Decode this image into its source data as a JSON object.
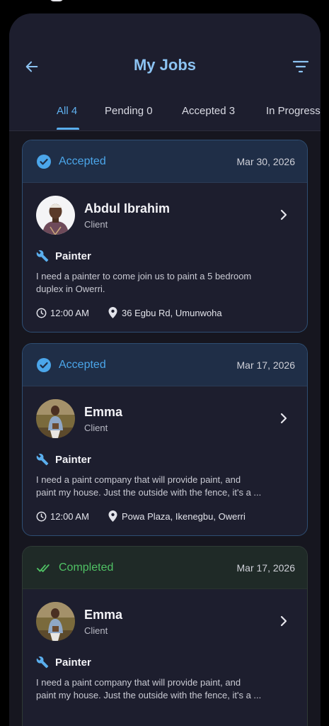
{
  "header": {
    "title": "My Jobs",
    "back_icon": "arrow-left-icon",
    "filter_icon": "filter-icon"
  },
  "tabs": [
    {
      "label": "All 4",
      "active": true
    },
    {
      "label": "Pending 0",
      "active": false
    },
    {
      "label": "Accepted 3",
      "active": false
    },
    {
      "label": "In Progress",
      "active": false
    }
  ],
  "colors": {
    "accent_blue": "#5fb0ef",
    "accepted": "#4ba6ea",
    "completed": "#4fc164",
    "background": "#16161f",
    "card": "#1d1e2e"
  },
  "jobs": [
    {
      "status": "Accepted",
      "status_icon": "check-circle-icon",
      "date": "Mar 30, 2026",
      "client_name": "Abdul Ibrahim",
      "client_role": "Client",
      "trade": "Painter",
      "description_line1": "I need a painter to come join us to paint a 5 bedroom",
      "description_line2": "duplex in Owerri.",
      "time": "12:00 AM",
      "location": "36 Egbu Rd, Umunwoha"
    },
    {
      "status": "Accepted",
      "status_icon": "check-circle-icon",
      "date": "Mar 17, 2026",
      "client_name": "Emma",
      "client_role": "Client",
      "trade": "Painter",
      "description_line1": "I need a paint company that will provide paint, and",
      "description_line2": "paint my house. Just the outside with the fence, it's a ...",
      "time": "12:00 AM",
      "location": "Powa Plaza, Ikenegbu, Owerri"
    },
    {
      "status": "Completed",
      "status_icon": "double-check-icon",
      "date": "Mar 17, 2026",
      "client_name": "Emma",
      "client_role": "Client",
      "trade": "Painter",
      "description_line1": "I need a paint company that will provide paint, and",
      "description_line2": "paint my house. Just the outside with the fence, it's a ..."
    }
  ]
}
